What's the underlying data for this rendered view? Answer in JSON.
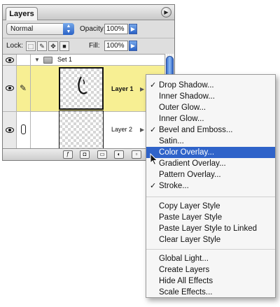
{
  "panel": {
    "tab_label": "Layers",
    "menu_button_icon": "triangle-right-icon",
    "blend_mode": "Normal",
    "opacity_label": "Opacity:",
    "opacity_value": "100%",
    "lock_label": "Lock:",
    "fill_label": "Fill:",
    "fill_value": "100%",
    "layers": [
      {
        "name": "Set 1",
        "type": "group",
        "visible": true
      },
      {
        "name": "Layer 1",
        "type": "layer",
        "visible": true,
        "selected": true,
        "highlight_color": "#f7ef93"
      },
      {
        "name": "Layer 2",
        "type": "layer",
        "visible": true,
        "selected": false
      }
    ],
    "bottom_buttons": [
      "layer-style-icon",
      "mask-icon",
      "new-set-icon",
      "adjustment-layer-icon",
      "new-layer-icon"
    ]
  },
  "menu": {
    "items": [
      {
        "label": "Drop Shadow...",
        "checked": true
      },
      {
        "label": "Inner Shadow...",
        "checked": false
      },
      {
        "label": "Outer Glow...",
        "checked": false
      },
      {
        "label": "Inner Glow...",
        "checked": false
      },
      {
        "label": "Bevel and Emboss...",
        "checked": true
      },
      {
        "label": "Satin...",
        "checked": false
      },
      {
        "label": "Color Overlay...",
        "checked": false,
        "highlighted": true
      },
      {
        "label": "Gradient Overlay...",
        "checked": false
      },
      {
        "label": "Pattern Overlay...",
        "checked": false
      },
      {
        "label": "Stroke...",
        "checked": true
      },
      {
        "label": "Copy Layer Style"
      },
      {
        "label": "Paste Layer Style"
      },
      {
        "label": "Paste Layer Style to Linked"
      },
      {
        "label": "Clear Layer Style"
      },
      {
        "label": "Global Light..."
      },
      {
        "label": "Create Layers"
      },
      {
        "label": "Hide All Effects"
      },
      {
        "label": "Scale Effects..."
      }
    ],
    "check_mark": "✓",
    "highlight_color": "#2f63c9"
  }
}
